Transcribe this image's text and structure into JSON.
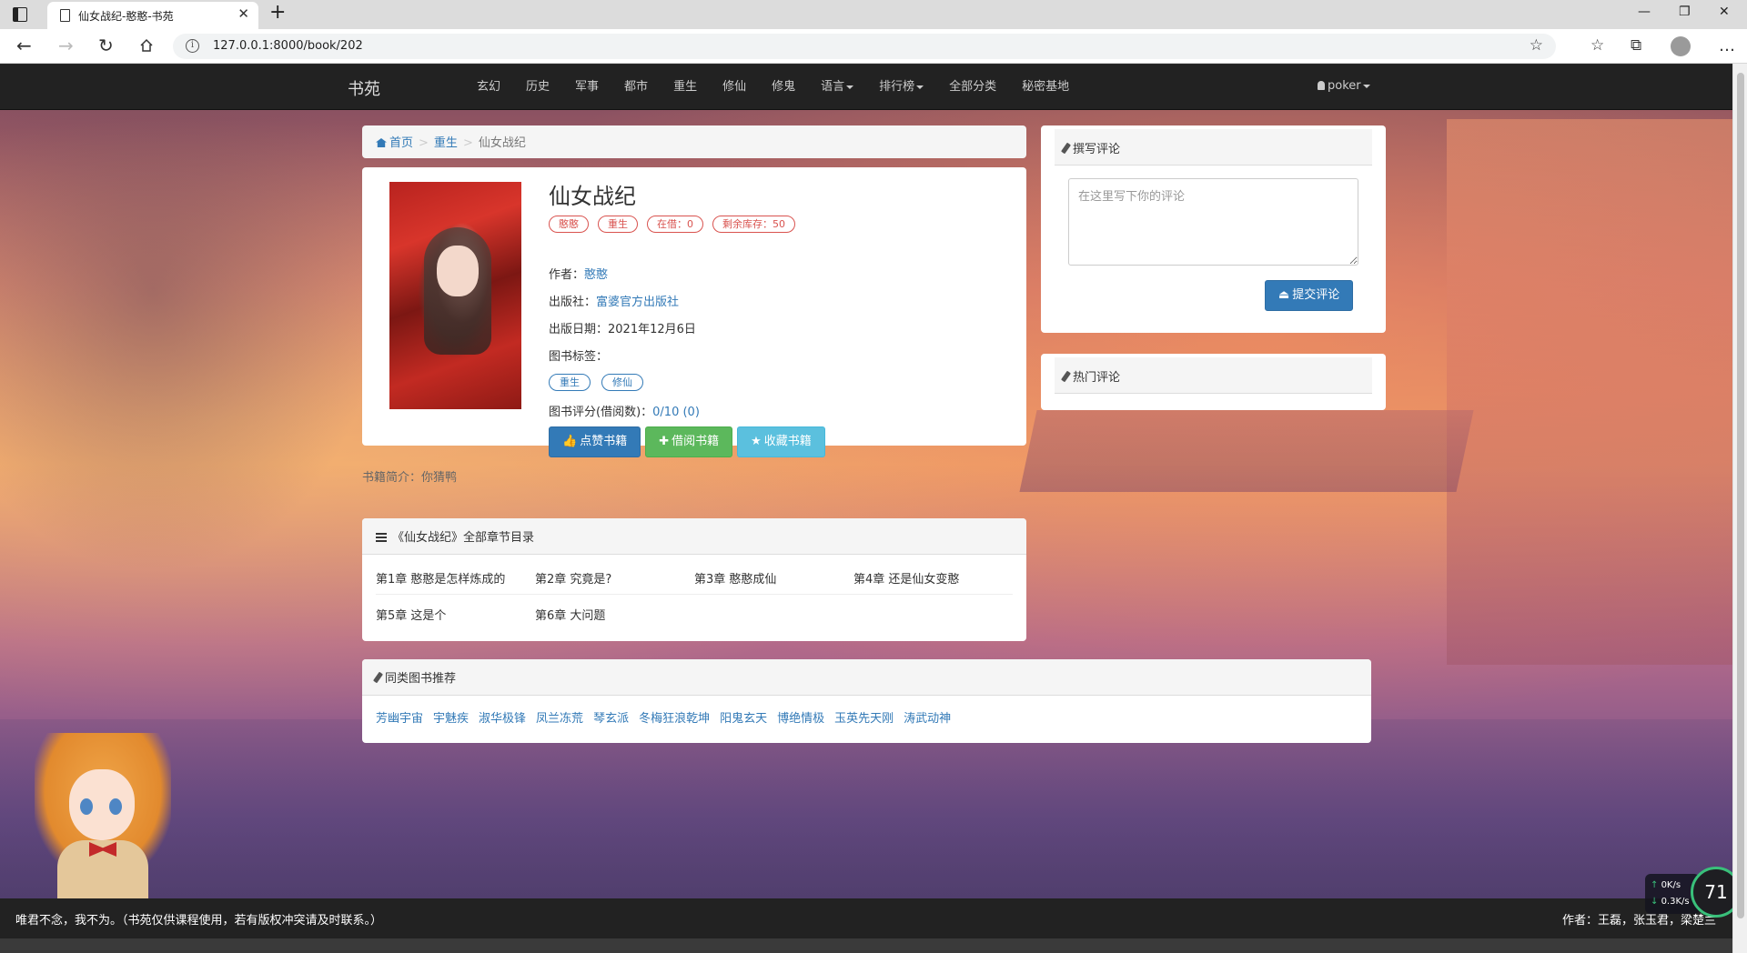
{
  "browser": {
    "tab_title": "仙女战纪-憨憨-书苑",
    "url": "127.0.0.1:8000/book/202"
  },
  "navbar": {
    "brand": "书苑",
    "links": [
      "玄幻",
      "历史",
      "军事",
      "都市",
      "重生",
      "修仙",
      "修鬼"
    ],
    "dropdown_language": "语言",
    "dropdown_ranking": "排行榜",
    "all_categories": "全部分类",
    "secret_base": "秘密基地",
    "user": "poker"
  },
  "breadcrumb": {
    "home": "首页",
    "category": "重生",
    "current": "仙女战纪"
  },
  "book": {
    "title": "仙女战纪",
    "badges": [
      "憨憨",
      "重生",
      "在借：0",
      "剩余库存：50"
    ],
    "author_label": "作者：",
    "author": "憨憨",
    "publisher_label": "出版社：",
    "publisher": "富婆官方出版社",
    "publish_date_label": "出版日期：",
    "publish_date": "2021年12月6日",
    "tags_label": "图书标签：",
    "tags": [
      "重生",
      "修仙"
    ],
    "rating_label": "图书评分(借阅数)：",
    "rating": "0/10 (0)",
    "like_button": "点赞书籍",
    "borrow_button": "借阅书籍",
    "collect_button": "收藏书籍",
    "intro_label": "书籍简介：",
    "intro": "你猜鸭"
  },
  "chapters": {
    "heading": "《仙女战纪》全部章节目录",
    "items": [
      "第1章 憨憨是怎样炼成的",
      "第2章 究竟是?",
      "第3章 憨憨成仙",
      "第4章 还是仙女变憨",
      "第5章 这是个",
      "第6章 大问题"
    ]
  },
  "recommend": {
    "heading": "同类图书推荐",
    "items": [
      "芳幽宇宙",
      "宇魅疾",
      "淑华极锋",
      "凤兰冻荒",
      "琴玄派",
      "冬梅狂浪乾坤",
      "阳鬼玄天",
      "博绝情极",
      "玉英先天刚",
      "涛武动神"
    ]
  },
  "comment": {
    "heading": "撰写评论",
    "placeholder": "在这里写下你的评论",
    "submit": "提交评论",
    "hot_heading": "热门评论"
  },
  "footer": {
    "left": "唯君不念，我不为。（书苑仅供课程使用，若有版权冲突请及时联系。）",
    "right": "作者：王磊，张玉君，梁楚兰"
  },
  "netspeed": {
    "up": "0K/s",
    "down": "0.3K/s",
    "gauge": "71"
  },
  "colors": {
    "navbar": "#222222",
    "link": "#337ab7",
    "danger": "#d9534f",
    "success": "#5cb85c",
    "info": "#5bc0de"
  }
}
